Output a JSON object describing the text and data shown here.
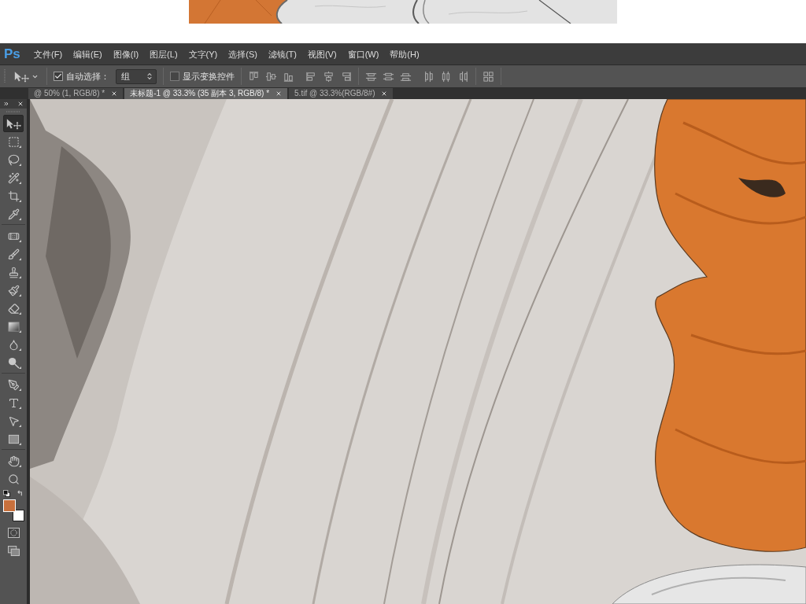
{
  "app": {
    "logo": "Ps"
  },
  "menu": [
    "文件(F)",
    "编辑(E)",
    "图像(I)",
    "图层(L)",
    "文字(Y)",
    "选择(S)",
    "滤镜(T)",
    "视图(V)",
    "窗口(W)",
    "帮助(H)"
  ],
  "options_bar": {
    "auto_select": {
      "label": "自动选择：",
      "checked": true
    },
    "auto_select_target": {
      "value": "组"
    },
    "transform_controls": {
      "label": "显示变换控件",
      "checked": false
    }
  },
  "tabs": [
    {
      "label": "@ 50% (1, RGB/8) *",
      "selected": false
    },
    {
      "label": "未标题-1 @ 33.3% (35 副本 3, RGB/8) *",
      "selected": true
    },
    {
      "label": "5.tif @ 33.3%(RGB/8#)",
      "selected": false
    }
  ],
  "tool_groups": [
    {
      "tools": [
        {
          "kind": "move",
          "selected": true,
          "flyout": false
        },
        {
          "kind": "marquee",
          "selected": false,
          "flyout": true
        },
        {
          "kind": "lasso",
          "selected": false,
          "flyout": true
        },
        {
          "kind": "magic_wand",
          "selected": false,
          "flyout": true
        },
        {
          "kind": "crop",
          "selected": false,
          "flyout": true
        },
        {
          "kind": "eyedropper",
          "selected": false,
          "flyout": true
        }
      ]
    },
    {
      "tools": [
        {
          "kind": "healing",
          "selected": false,
          "flyout": true
        },
        {
          "kind": "brush",
          "selected": false,
          "flyout": true
        },
        {
          "kind": "stamp",
          "selected": false,
          "flyout": true
        },
        {
          "kind": "history_brush",
          "selected": false,
          "flyout": true
        },
        {
          "kind": "eraser",
          "selected": false,
          "flyout": true
        },
        {
          "kind": "gradient",
          "selected": false,
          "flyout": true
        },
        {
          "kind": "blur",
          "selected": false,
          "flyout": true
        },
        {
          "kind": "dodge",
          "selected": false,
          "flyout": true
        }
      ]
    },
    {
      "tools": [
        {
          "kind": "pen",
          "selected": false,
          "flyout": true
        },
        {
          "kind": "type",
          "selected": false,
          "flyout": true
        },
        {
          "kind": "path_select",
          "selected": false,
          "flyout": true
        },
        {
          "kind": "shape",
          "selected": false,
          "flyout": true
        }
      ]
    },
    {
      "tools": [
        {
          "kind": "hand",
          "selected": false,
          "flyout": true
        },
        {
          "kind": "zoom",
          "selected": false,
          "flyout": false
        }
      ]
    }
  ],
  "color_swatches": [
    {
      "kind": "foreground",
      "color": "#c8703c"
    },
    {
      "kind": "background",
      "color": "#ffffff"
    }
  ]
}
